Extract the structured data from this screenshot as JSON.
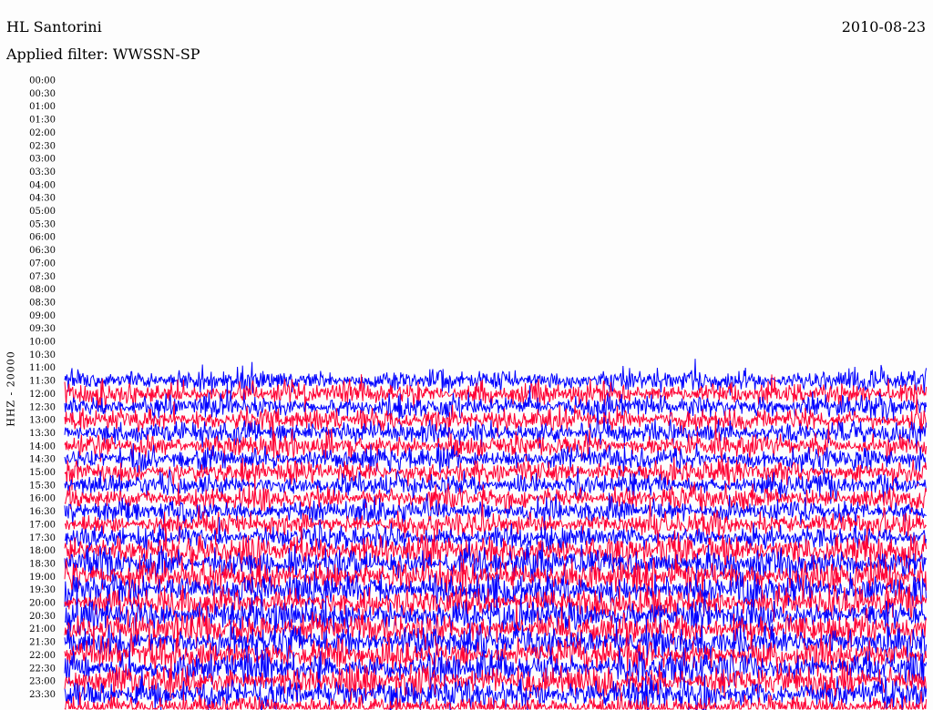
{
  "header": {
    "station": "HL Santorini",
    "date": "2010-08-23",
    "filter": "Applied filter: WWSSN-SP"
  },
  "chart_data": {
    "type": "line",
    "subtype": "helicorder",
    "title": "HL Santorini",
    "date": "2010-08-23",
    "filter": "WWSSN-SP",
    "ylabel": "HHZ - 20000",
    "row_labels": [
      "00:00",
      "00:30",
      "01:00",
      "01:30",
      "02:00",
      "02:30",
      "03:00",
      "03:30",
      "04:00",
      "04:30",
      "05:00",
      "05:30",
      "06:00",
      "06:30",
      "07:00",
      "07:30",
      "08:00",
      "08:30",
      "09:00",
      "09:30",
      "10:00",
      "10:30",
      "11:00",
      "11:30",
      "12:00",
      "12:30",
      "13:00",
      "13:30",
      "14:00",
      "14:30",
      "15:00",
      "15:30",
      "16:00",
      "16:30",
      "17:00",
      "17:30",
      "18:00",
      "18:30",
      "19:00",
      "19:30",
      "20:00",
      "20:30",
      "21:00",
      "21:30",
      "22:00",
      "22:30",
      "23:00",
      "23:30"
    ],
    "series_colors": [
      "#0000ff",
      "#ff0033"
    ],
    "data_start": "11:30",
    "grid": false,
    "legend": "none"
  }
}
